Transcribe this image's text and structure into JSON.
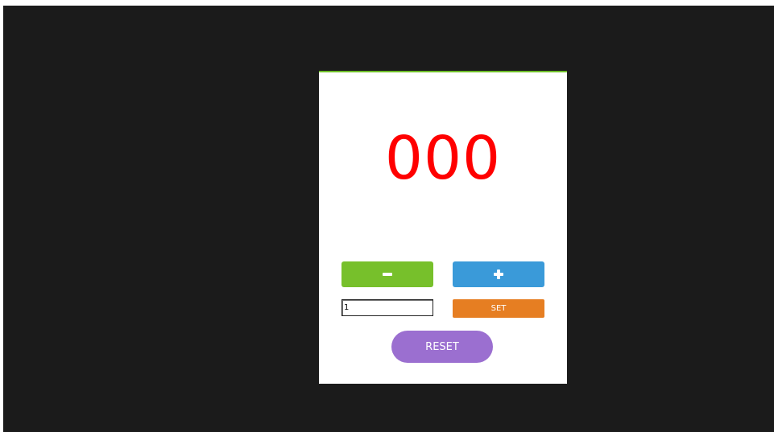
{
  "counter": {
    "value": "000",
    "color": "#ff0000"
  },
  "controls": {
    "decrement_icon": "minus-icon",
    "increment_icon": "plus-icon",
    "step_input_value": "1",
    "set_label": "SET",
    "reset_label": "RESET"
  },
  "colors": {
    "background": "#1b1b1b",
    "card": "#ffffff",
    "card_top_border": "#6fbf2a",
    "decrement_button": "#77c02b",
    "increment_button": "#3a9ad9",
    "set_button": "#e67e22",
    "reset_button": "#9b6fd0"
  }
}
